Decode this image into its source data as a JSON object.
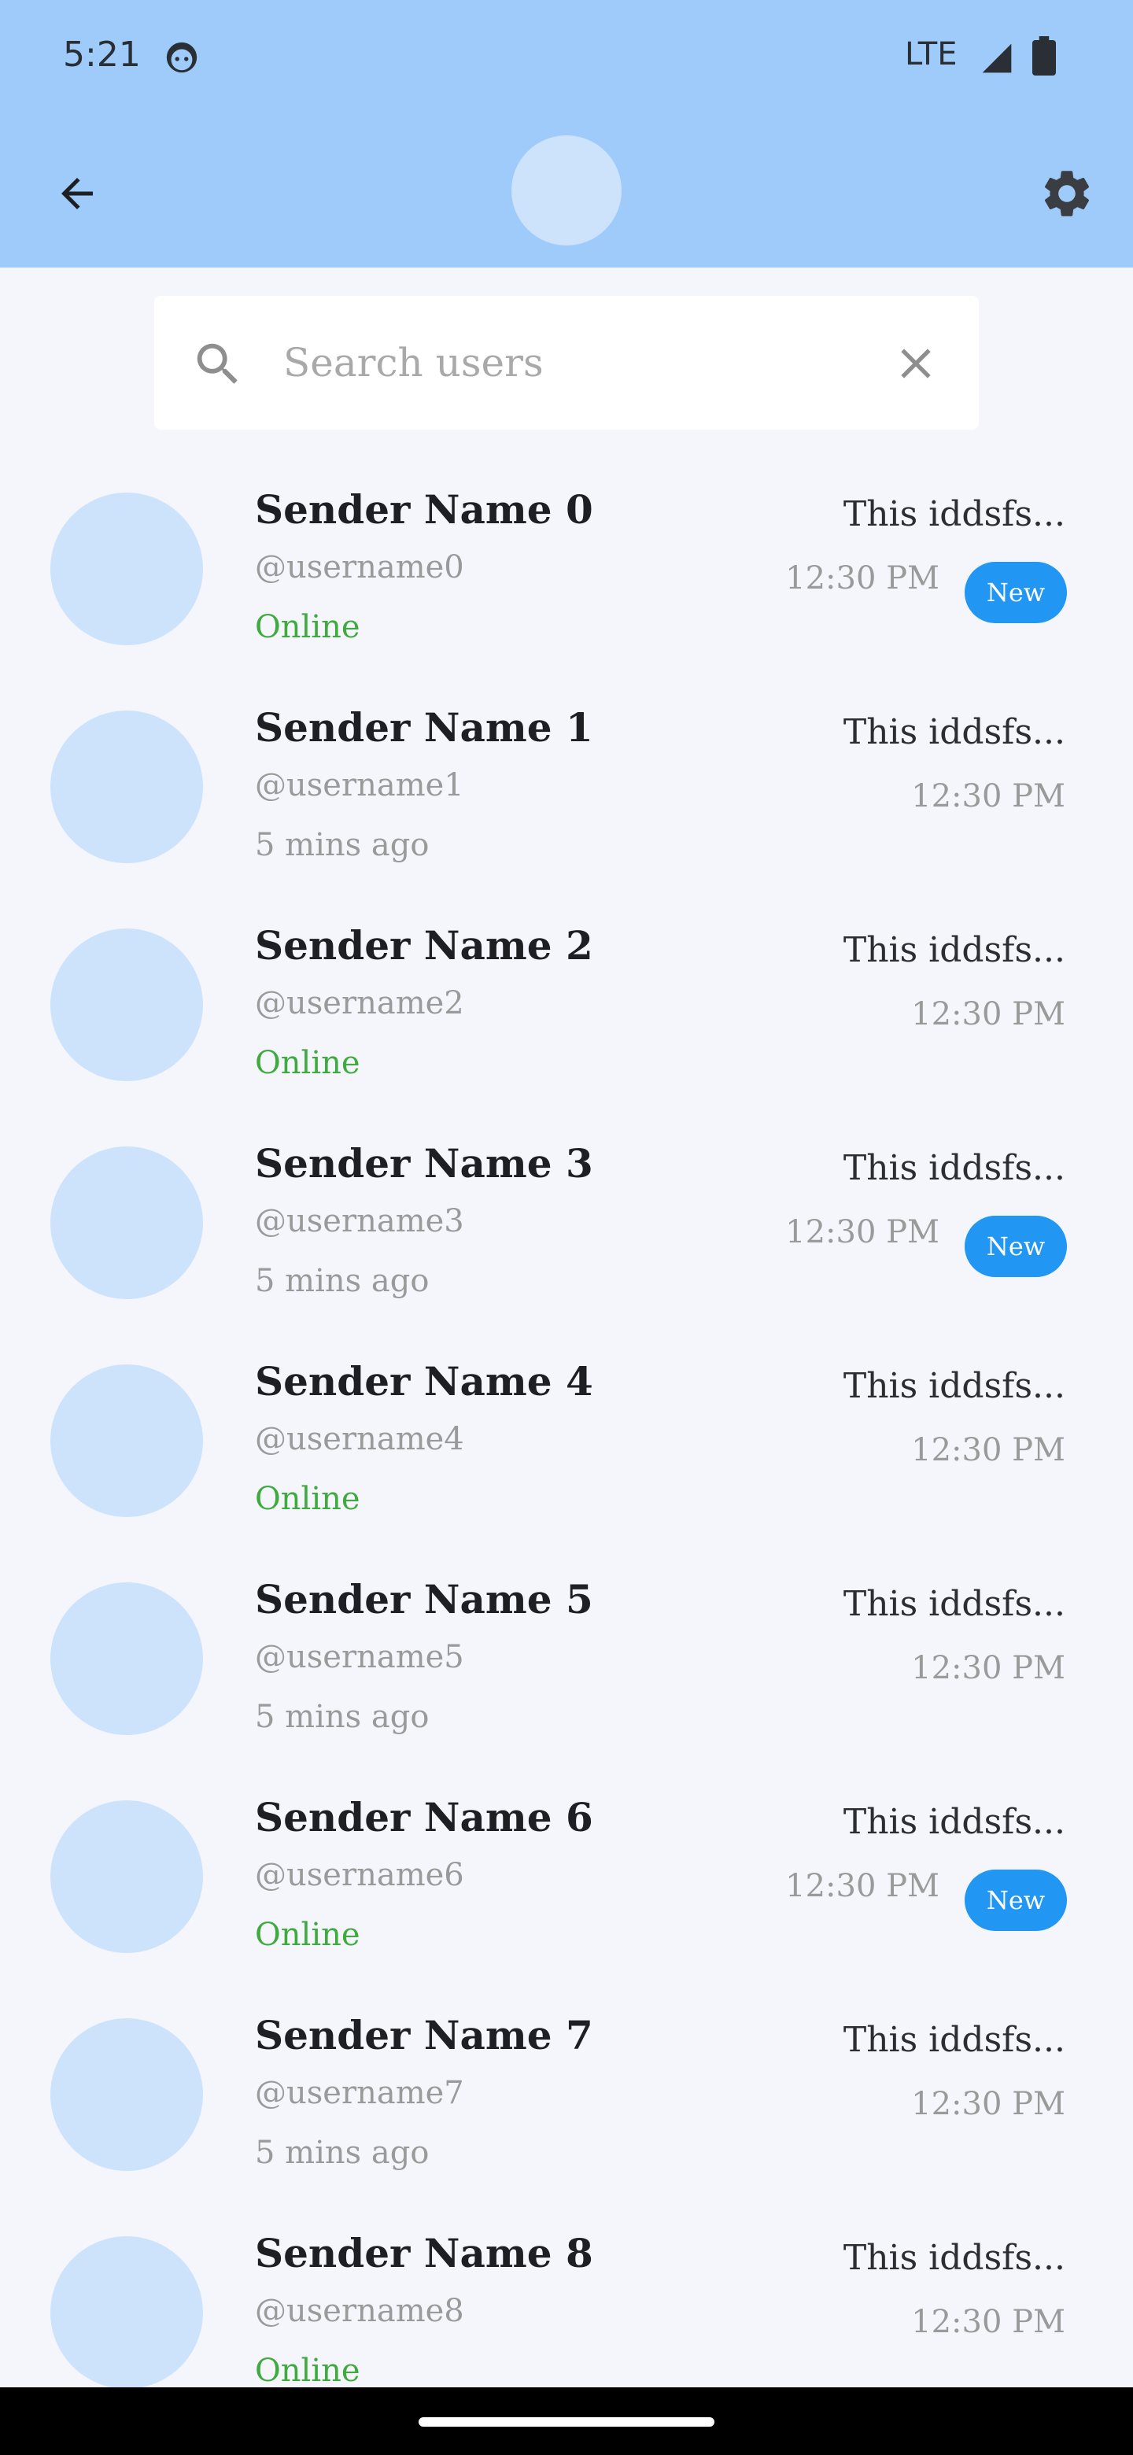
{
  "status_bar": {
    "time": "5:21",
    "network": "LTE",
    "icons": [
      "face-icon",
      "signal-icon",
      "battery-icon"
    ]
  },
  "app_bar": {
    "back_icon": "arrow-back-icon",
    "settings_icon": "gear-icon"
  },
  "search": {
    "placeholder": "Search users",
    "value": "",
    "search_icon": "search-icon",
    "clear_icon": "close-icon"
  },
  "colors": {
    "header": "#9ecbfa",
    "avatar": "#cde3fc",
    "online": "#3faa3f",
    "badge": "#2196f3",
    "background": "#f5f6fc"
  },
  "users": [
    {
      "name": "Sender Name 0",
      "username": "@username0",
      "status": "Online",
      "message": "This iddsfs...",
      "time": "12:30 PM",
      "badge": "New"
    },
    {
      "name": "Sender Name 1",
      "username": "@username1",
      "status": "5 mins ago",
      "message": "This iddsfs...",
      "time": "12:30 PM",
      "badge": ""
    },
    {
      "name": "Sender Name 2",
      "username": "@username2",
      "status": "Online",
      "message": "This iddsfs...",
      "time": "12:30 PM",
      "badge": ""
    },
    {
      "name": "Sender Name 3",
      "username": "@username3",
      "status": "5 mins ago",
      "message": "This iddsfs...",
      "time": "12:30 PM",
      "badge": "New"
    },
    {
      "name": "Sender Name 4",
      "username": "@username4",
      "status": "Online",
      "message": "This iddsfs...",
      "time": "12:30 PM",
      "badge": ""
    },
    {
      "name": "Sender Name 5",
      "username": "@username5",
      "status": "5 mins ago",
      "message": "This iddsfs...",
      "time": "12:30 PM",
      "badge": ""
    },
    {
      "name": "Sender Name 6",
      "username": "@username6",
      "status": "Online",
      "message": "This iddsfs...",
      "time": "12:30 PM",
      "badge": "New"
    },
    {
      "name": "Sender Name 7",
      "username": "@username7",
      "status": "5 mins ago",
      "message": "This iddsfs...",
      "time": "12:30 PM",
      "badge": ""
    },
    {
      "name": "Sender Name 8",
      "username": "@username8",
      "status": "Online",
      "message": "This iddsfs...",
      "time": "12:30 PM",
      "badge": ""
    }
  ]
}
